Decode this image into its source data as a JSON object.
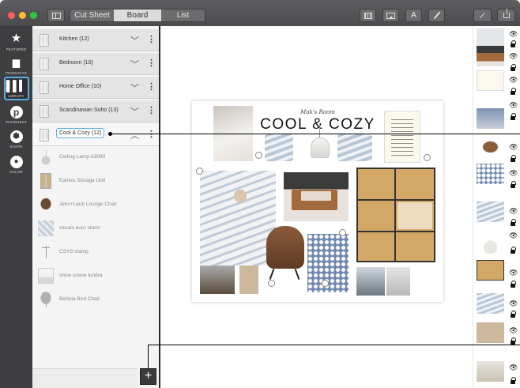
{
  "toolbar": {
    "tabs": [
      {
        "label": "Cut Sheet"
      },
      {
        "label": "Board"
      },
      {
        "label": "List"
      }
    ],
    "active_tab": "Board"
  },
  "rail": {
    "items": [
      {
        "label": "Featured",
        "icon": "star-icon"
      },
      {
        "label": "Products",
        "icon": "chair-icon"
      },
      {
        "label": "Library",
        "icon": "library-icon"
      },
      {
        "label": "Pinterest",
        "icon": "pinterest-icon"
      },
      {
        "label": "Shape",
        "icon": "shape-icon"
      },
      {
        "label": "Color",
        "icon": "color-drop-icon"
      }
    ]
  },
  "sidebar": {
    "categories": [
      {
        "label": "Kitchen (12)"
      },
      {
        "label": "Bedroom (10)"
      },
      {
        "label": "Home Office (10)"
      },
      {
        "label": "Scandinavian Soho (13)"
      },
      {
        "label": "Cool & Cozy (12)"
      }
    ],
    "items": [
      {
        "label": "Ceiling Lamp A3080"
      },
      {
        "label": "Eames Storage Unit"
      },
      {
        "label": "Jehs+Laub Lounge Chair"
      },
      {
        "label": "clouds euro storm"
      },
      {
        "label": "CSYS clamp"
      },
      {
        "label": "snow scene tundra"
      },
      {
        "label": "Bertoia Bird Chair"
      }
    ]
  },
  "board": {
    "subtitle": "Mak's Room",
    "title": "COOL & COZY"
  },
  "colors": {
    "accent": "#5ab0e8",
    "rail_bg": "#3e3e40",
    "titlebar": "#555557"
  }
}
